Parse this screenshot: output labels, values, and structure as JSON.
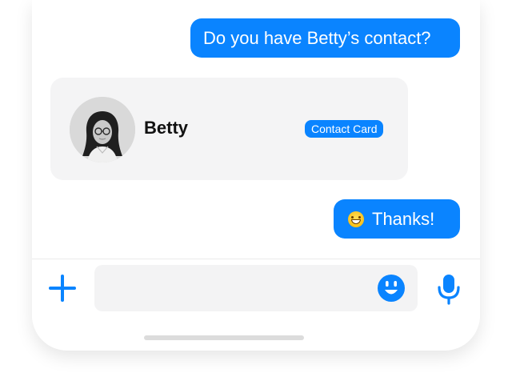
{
  "theme": {
    "accent": "#0a84ff",
    "bubble_text": "#ffffff",
    "card_background": "#f4f4f5",
    "input_background": "#f3f3f4"
  },
  "messages": [
    {
      "direction": "outgoing",
      "text": "Do you have Betty’s contact?"
    },
    {
      "direction": "incoming",
      "type": "contact-card",
      "name": "Betty",
      "tag": "Contact Card",
      "avatar": "avatar-photo"
    },
    {
      "direction": "outgoing",
      "emoji": "grinning-face-emoji",
      "text": "Thanks!"
    }
  ],
  "composer": {
    "value": "",
    "placeholder": "",
    "icons": [
      "plus-icon",
      "sticker-icon",
      "microphone-icon"
    ]
  }
}
